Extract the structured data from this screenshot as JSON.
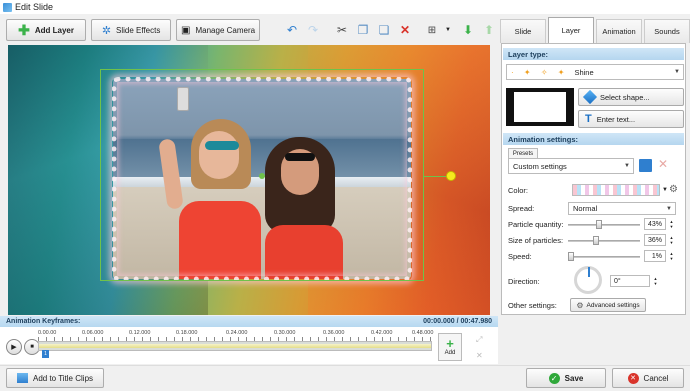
{
  "window": {
    "title": "Edit Slide"
  },
  "toolbar": {
    "add_layer": "Add Layer",
    "slide_effects": "Slide Effects",
    "manage_camera": "Manage Camera"
  },
  "tabs": [
    {
      "label": "Slide",
      "active": false
    },
    {
      "label": "Layer",
      "active": true
    },
    {
      "label": "Animation",
      "active": false
    },
    {
      "label": "Sounds",
      "active": false
    }
  ],
  "layer_type": {
    "header": "Layer type:",
    "value": "Shine",
    "select_shape": "Select shape...",
    "enter_text": "Enter text..."
  },
  "animation_settings": {
    "header": "Animation settings:",
    "presets_tab": "Presets",
    "preset_value": "Custom settings",
    "color_label": "Color:",
    "spread_label": "Spread:",
    "spread_value": "Normal",
    "particle_quantity_label": "Particle quantity:",
    "particle_quantity_value": "43%",
    "size_of_particles_label": "Size of particles:",
    "size_of_particles_value": "36%",
    "speed_label": "Speed:",
    "speed_value": "1%",
    "direction_label": "Direction:",
    "direction_value": "0°",
    "other_settings_label": "Other settings:",
    "advanced_settings": "Advanced settings"
  },
  "keyframes": {
    "header": "Animation Keyframes:",
    "time_display": "00:00.000 / 00:47.980",
    "ruler": [
      "0.00.00",
      "0.06.000",
      "0.12.000",
      "0.18.000",
      "0.24.000",
      "0.30.000",
      "0.36.000",
      "0.42.000",
      "0.48.000"
    ],
    "marker": "1",
    "add_label": "Add"
  },
  "footer": {
    "add_to_title_clips": "Add to Title Clips",
    "save": "Save",
    "cancel": "Cancel"
  },
  "colors": {
    "accent": "#2f7fcf",
    "selection": "#6fc24a",
    "handle": "#f6ea1e",
    "save_check": "#2fa83a",
    "cancel_x": "#d9342b"
  }
}
